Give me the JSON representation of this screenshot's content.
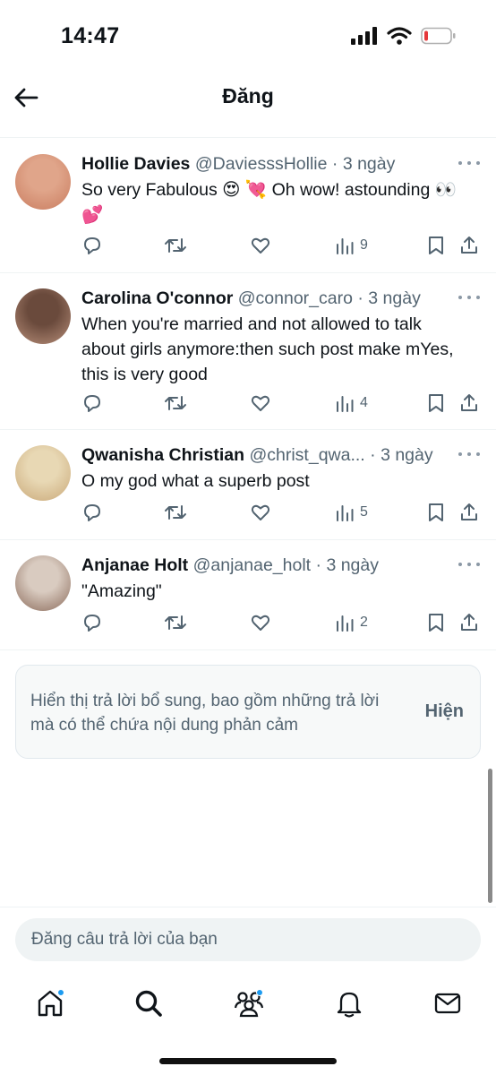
{
  "status_bar": {
    "time": "14:47"
  },
  "header": {
    "title": "Đăng"
  },
  "replies": [
    {
      "name": "Hollie Davies",
      "handle": "@DaviesssHollie",
      "separator": "·",
      "time": "3 ngày",
      "text": "So very Fabulous 😍 💘 Oh wow!  astounding 👀 💕",
      "views": "9",
      "avatar_colors": [
        "#e0a58a",
        "#c97c5f"
      ]
    },
    {
      "name": "Carolina O'connor",
      "handle": "@connor_caro",
      "separator": "·",
      "time": "3 ngày",
      "text": "When you're married and not allowed to talk about girls anymore:then such post make mYes, this is very good",
      "views": "4",
      "avatar_colors": [
        "#6a4a3c",
        "#b88f7a"
      ]
    },
    {
      "name": "Qwanisha Christian",
      "handle": "@christ_qwa...",
      "separator": "·",
      "time": "3 ngày",
      "text": "O my god what a superb post",
      "views": "5",
      "avatar_colors": [
        "#e8d8b4",
        "#c9a878"
      ]
    },
    {
      "name": "Anjanae Holt",
      "handle": "@anjanae_holt",
      "separator": "·",
      "time": "3 ngày",
      "text": "\"Amazing\"",
      "views": "2",
      "avatar_colors": [
        "#d9cbc0",
        "#8a6a5a"
      ]
    }
  ],
  "notice": {
    "text": "Hiển thị trả lời bổ sung, bao gồm những trả lời mà có thể chứa nội dung phản cảm",
    "button_label": "Hiện"
  },
  "compose": {
    "placeholder": "Đăng câu trả lời của bạn"
  },
  "tab_bar": {
    "items": [
      "home-icon",
      "search-icon",
      "communities-icon",
      "notifications-icon",
      "messages-icon"
    ]
  },
  "colors": {
    "accent": "#1d9bf0",
    "text": "#0f1419",
    "secondary": "#536471"
  }
}
